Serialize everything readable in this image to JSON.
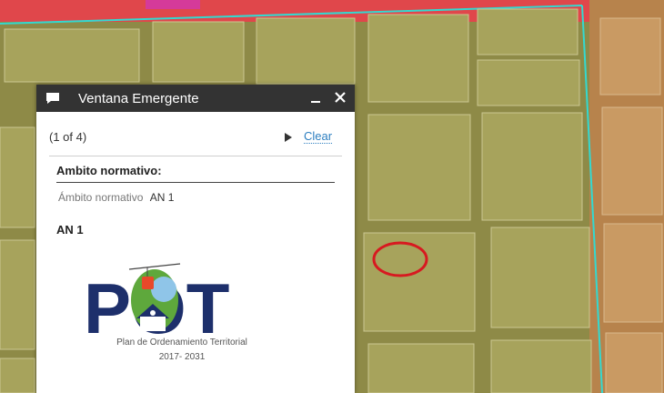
{
  "popup": {
    "title": "Ventana Emergente",
    "minimize_symbol": "–",
    "close_symbol": "✕",
    "counter": "(1 of 4)",
    "clear_label": "Clear",
    "section_title": "Ambito normativo:",
    "field_label": "Ámbito normativo",
    "field_value": "AN 1",
    "heading": "AN 1",
    "logo": {
      "text": "POT",
      "subtitle": "Plan de Ordenamiento Territorial",
      "years": "2017- 2031"
    }
  },
  "colors": {
    "map_base": "#8f8f4a",
    "block_fill": "#a7a35c",
    "zone_red": "#e0474b",
    "zone_orange": "#b7834c",
    "boundary_cyan": "#33d9d0",
    "marker_red": "#d71920",
    "popup_header": "#333333",
    "link_blue": "#2d7fc0",
    "logo_navy": "#1d2f6b",
    "logo_green": "#5ea83c"
  },
  "icons": [
    "chat-icon",
    "minimize-icon",
    "close-icon",
    "next-arrow-icon",
    "cable-car-icon",
    "house-icon"
  ]
}
